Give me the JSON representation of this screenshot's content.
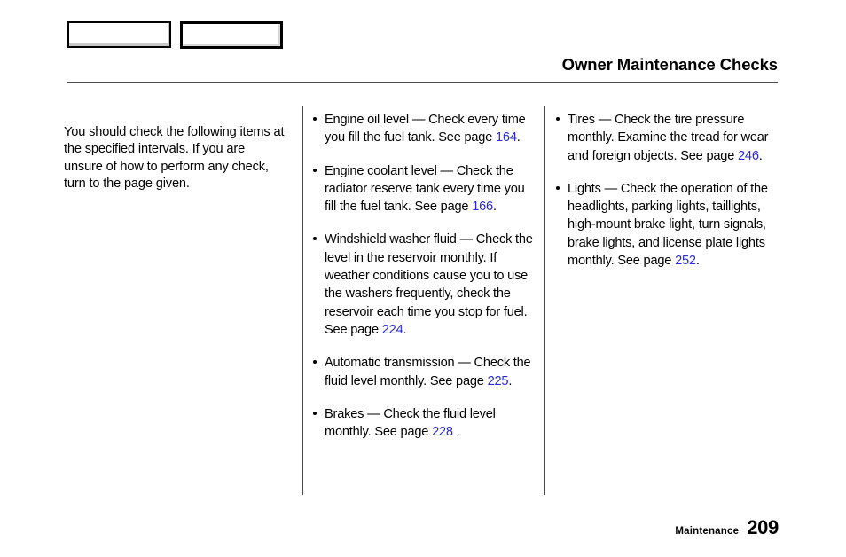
{
  "nav": {
    "prev_label": "",
    "next_label": ""
  },
  "header": {
    "title": "Owner Maintenance Checks"
  },
  "intro": {
    "text": "You should check the following items at the specified intervals. If you are unsure of how to perform any check, turn to the page given."
  },
  "middle_column": {
    "items": [
      {
        "before": "Engine oil level — Check every time you fill the fuel tank. See page ",
        "link": "164",
        "after": "."
      },
      {
        "before": "Engine coolant level — Check the radiator reserve tank every time you fill the fuel tank. See page ",
        "link": "166",
        "after": "."
      },
      {
        "before": "Windshield washer fluid — Check the level in the reservoir monthly. If weather conditions cause you to use the washers frequently, check the reservoir each time you stop for fuel. See page ",
        "link": "224",
        "after": "."
      },
      {
        "before": "Automatic transmission — Check the fluid level monthly. See page ",
        "link": "225",
        "after": "."
      },
      {
        "before": "Brakes — Check the fluid level monthly. See page ",
        "link": "228",
        "after": " ."
      }
    ]
  },
  "right_column": {
    "items": [
      {
        "before": "Tires — Check the tire pressure monthly. Examine the tread for wear and foreign objects. See page ",
        "link": "246",
        "after": "."
      },
      {
        "before": "Lights — Check the operation of the headlights, parking lights, taillights, high-mount brake light, turn signals, brake lights, and license plate lights monthly. See page ",
        "link": "252",
        "after": "."
      }
    ]
  },
  "footer": {
    "section": "Maintenance",
    "page_number": "209"
  },
  "colors": {
    "link": "#2b2bd0",
    "rule": "#4a4a4a",
    "text": "#000000"
  }
}
